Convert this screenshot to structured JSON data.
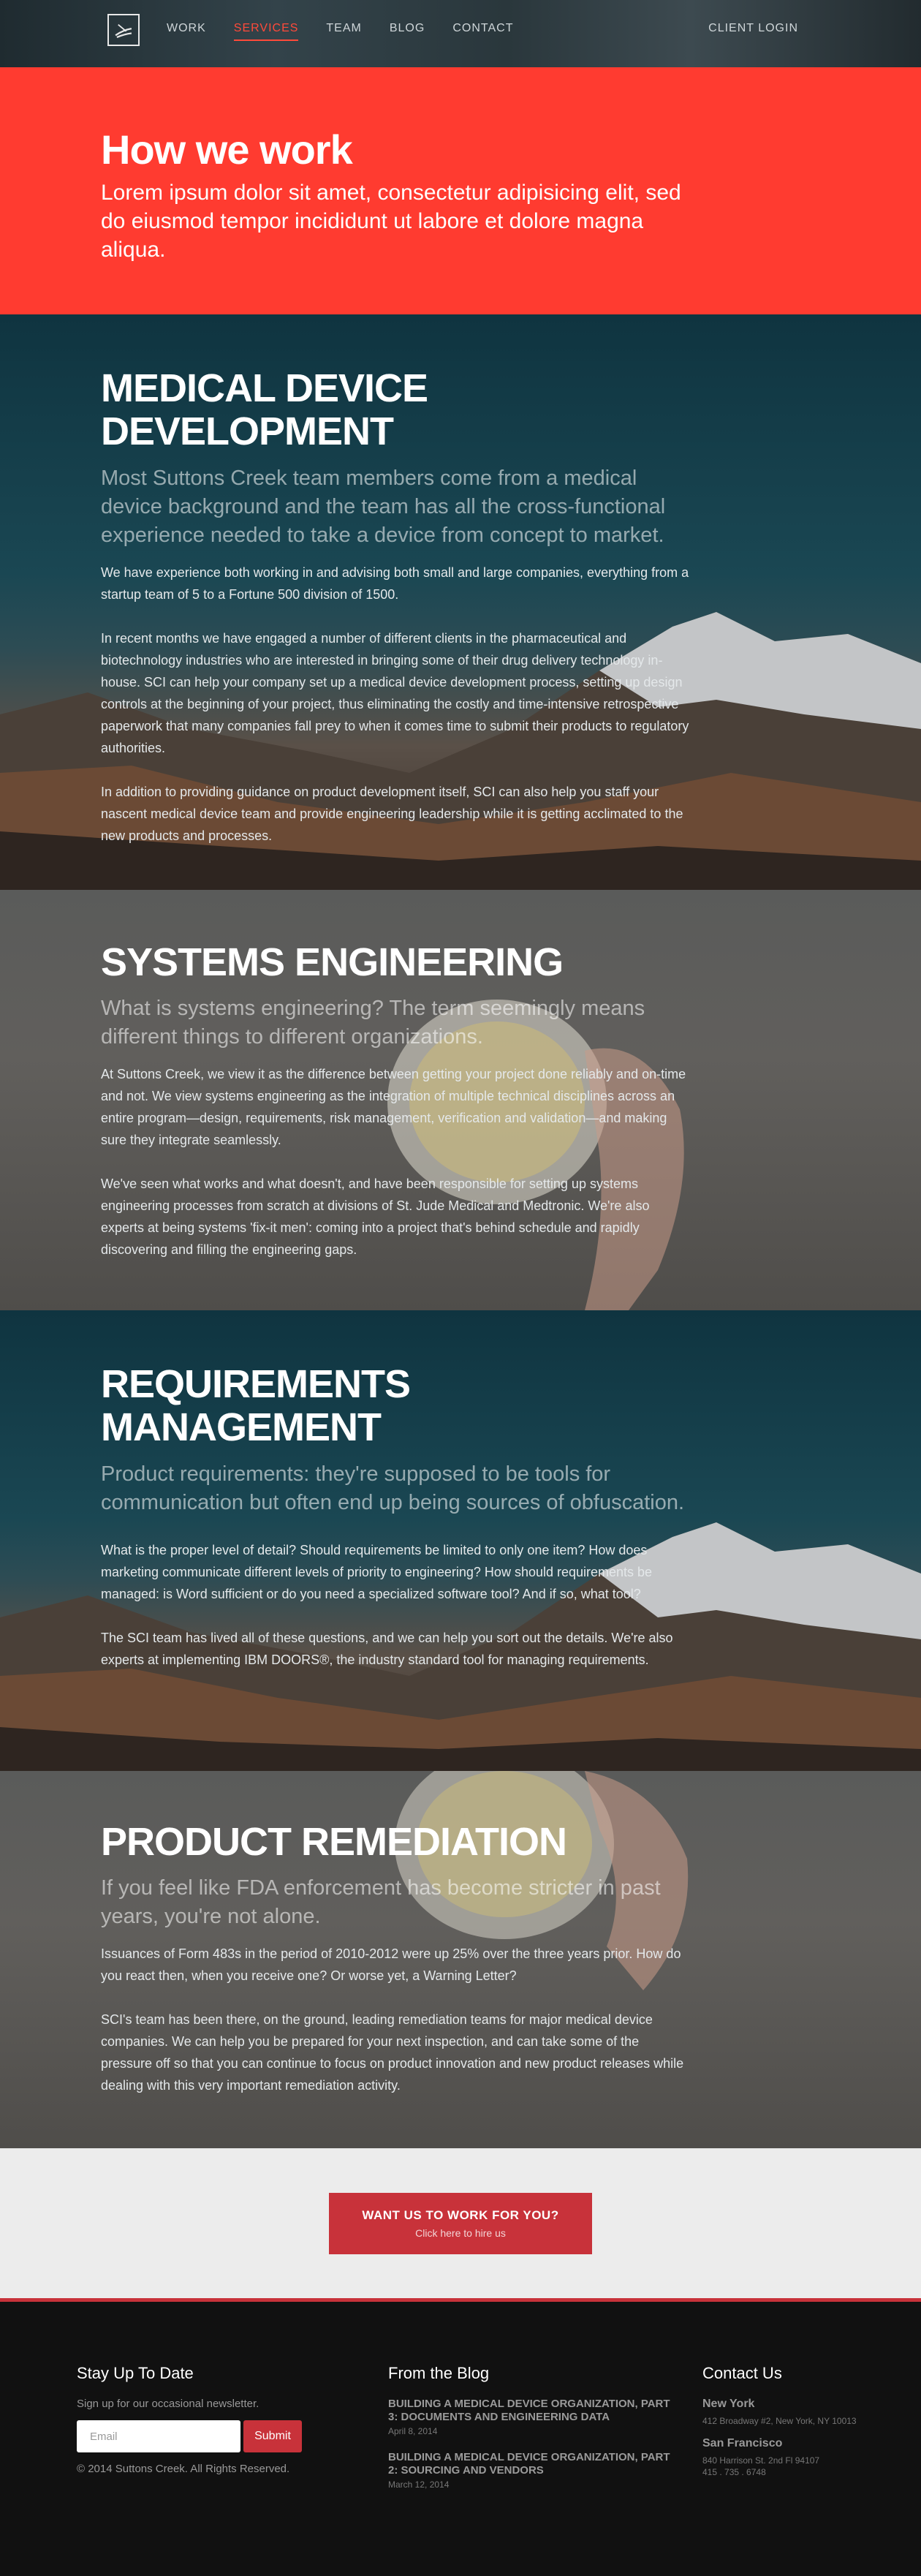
{
  "nav": {
    "items": [
      "WORK",
      "SERVICES",
      "TEAM",
      "BLOG",
      "CONTACT"
    ],
    "active": "SERVICES",
    "client_login": "CLIENT LOGIN"
  },
  "hero": {
    "title": "How we work",
    "lead": "Lorem ipsum dolor sit amet, consectetur adipisicing elit, sed do eiusmod tempor incididunt ut labore et dolore magna aliqua."
  },
  "sections": [
    {
      "title": "MEDICAL DEVICE DEVELOPMENT",
      "lead": "Most Suttons Creek team members come from a medical device background and the team has all the cross-functional experience needed to take a device from concept to market.",
      "paragraphs": [
        "We have experience both working in and advising both small and large companies, everything from a startup team of 5 to a Fortune 500 division of 1500.",
        "In recent months we have engaged a number of different clients in the pharmaceutical and biotechnology industries who are interested in bringing some of their drug delivery technology in-house. SCI can help your company set up a medical device development process, setting up design controls at the beginning of your project, thus eliminating the costly and time-intensive retrospective paperwork that many companies fall prey to when it comes time to submit their products to regulatory authorities.",
        "In addition to providing guidance on product development itself, SCI can also help you staff your nascent medical device team and provide engineering leadership while it is getting acclimated to the new products and processes."
      ]
    },
    {
      "title": "SYSTEMS ENGINEERING",
      "lead": "What is systems engineering? The term seemingly means different things to different organizations.",
      "paragraphs": [
        "At Suttons Creek, we view it as the difference between getting your project done reliably and on-time and not. We view systems engineering as the integration of multiple technical disciplines across an entire program—design, requirements, risk management, verification and validation—and making sure they integrate seamlessly.",
        "We've seen what works and what doesn't, and have been responsible for setting up systems engineering processes from scratch at divisions of St. Jude Medical and Medtronic. We're also experts at being systems 'fix-it men': coming into a project that's behind schedule and rapidly discovering and filling the engineering gaps."
      ]
    },
    {
      "title": "REQUIREMENTS MANAGEMENT",
      "lead": "Product requirements: they're supposed to be tools for communication but often end up being sources of obfuscation.",
      "paragraphs": [
        "What is the proper level of detail? Should requirements be limited to only one item? How does marketing communicate different levels of priority to engineering? How should requirements be managed: is Word sufficient or do you need a specialized software tool? And if so, what tool?",
        "The SCI team has lived all of these questions, and we can help you sort out the details. We're also experts at implementing IBM DOORS®, the industry standard tool for managing requirements."
      ]
    },
    {
      "title": "PRODUCT REMEDIATION",
      "lead": "If you feel like FDA enforcement has become stricter in past years, you're not alone.",
      "paragraphs": [
        "Issuances of Form 483s in the period of 2010-2012 were up 25% over the three years prior. How do you react then, when you receive one? Or worse yet, a Warning Letter?",
        "SCI's team has been there, on the ground, leading remediation teams for major medical device companies. We can help you be prepared for your next inspection, and can take some of the pressure off so that you can continue to focus on product innovation and new product releases while dealing with this very important remediation activity."
      ]
    }
  ],
  "cta": {
    "title": "WANT US TO WORK FOR YOU?",
    "subtitle": "Click here to hire us"
  },
  "footer": {
    "newsletter_title": "Stay Up To Date",
    "newsletter_text": "Sign up for our occasional newsletter.",
    "email_placeholder": "Email",
    "submit_label": "Submit",
    "copyright": "© 2014 Suttons Creek. All Rights Reserved.",
    "blog_title": "From the Blog",
    "posts": [
      {
        "title": "BUILDING A MEDICAL DEVICE ORGANIZATION, PART 3: DOCUMENTS AND ENGINEERING DATA",
        "date": "April 8, 2014"
      },
      {
        "title": "BUILDING A MEDICAL DEVICE ORGANIZATION, PART 2: SOURCING AND VENDORS",
        "date": "March 12, 2014"
      }
    ],
    "contact_title": "Contact Us",
    "offices": [
      {
        "city": "New York",
        "lines": [
          "412 Broadway #2, New York, NY 10013"
        ]
      },
      {
        "city": "San Francisco",
        "lines": [
          "840 Harrison St. 2nd Fl 94107",
          "415 . 735 . 6748"
        ]
      }
    ]
  },
  "colors": {
    "accent": "#ff3b30",
    "button": "#c8323a"
  }
}
